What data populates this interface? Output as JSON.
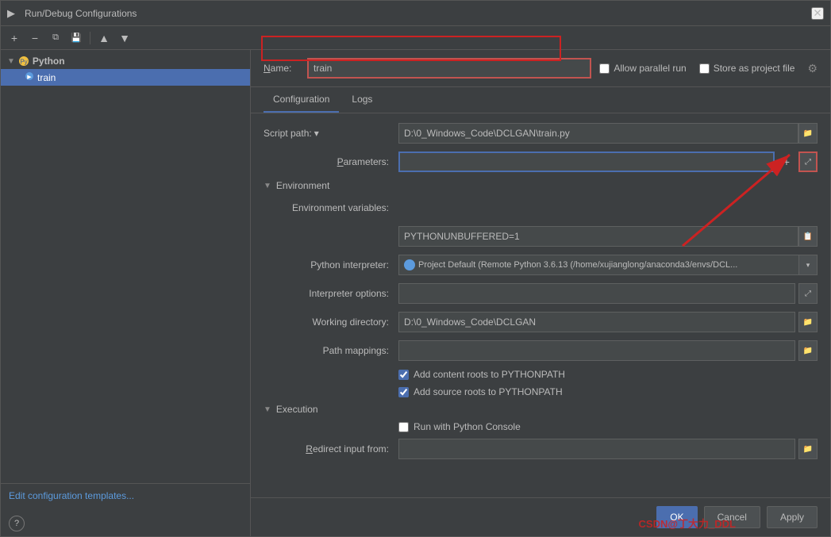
{
  "titleBar": {
    "icon": "▶",
    "title": "Run/Debug Configurations",
    "closeLabel": "✕"
  },
  "toolbar": {
    "addBtn": "+",
    "removeBtn": "−",
    "copyBtn": "⧉",
    "saveBtn": "💾",
    "moveUpBtn": "↑",
    "moveDownBtn": "↓"
  },
  "sidebar": {
    "pythonGroup": {
      "label": "Python",
      "arrow": "▼",
      "items": [
        {
          "label": "train",
          "selected": true
        }
      ]
    },
    "editTemplatesLink": "Edit configuration templates...",
    "helpBtn": "?"
  },
  "nameRow": {
    "label": "Name:",
    "value": "train",
    "allowParallelRun": "Allow parallel run",
    "storeAsProjectFile": "Store as project file"
  },
  "tabs": [
    {
      "label": "Configuration",
      "active": true
    },
    {
      "label": "Logs",
      "active": false
    }
  ],
  "config": {
    "scriptPath": {
      "label": "Script path:",
      "value": "D:\\0_Windows_Code\\DCLGAN\\train.py"
    },
    "parameters": {
      "label": "Parameters:",
      "value": ""
    },
    "environment": {
      "sectionLabel": "Environment",
      "arrow": "▼",
      "envVarsLabel": "Environment variables:",
      "envVarsValue": "PYTHONUNBUFFERED=1"
    },
    "pythonInterpreter": {
      "label": "Python interpreter:",
      "value": "Project Default (Remote Python 3.6.13 (/home/xujianglong/anaconda3/envs/DCL..."
    },
    "interpreterOptions": {
      "label": "Interpreter options:",
      "value": ""
    },
    "workingDirectory": {
      "label": "Working directory:",
      "value": "D:\\0_Windows_Code\\DCLGAN"
    },
    "pathMappings": {
      "label": "Path mappings:",
      "value": ""
    },
    "addContentRoots": {
      "label": "Add content roots to PYTHONPATH",
      "checked": true
    },
    "addSourceRoots": {
      "label": "Add source roots to PYTHONPATH",
      "checked": true
    },
    "execution": {
      "sectionLabel": "Execution",
      "arrow": "▼"
    },
    "runWithPythonConsole": {
      "label": "Run with Python Console",
      "checked": false
    },
    "redirectInputFrom": {
      "label": "Redirect input from:",
      "value": ""
    }
  },
  "footer": {
    "okLabel": "OK",
    "cancelLabel": "Cancel",
    "applyLabel": "Apply"
  },
  "watermark": "CSDN@丁大力_DDL"
}
